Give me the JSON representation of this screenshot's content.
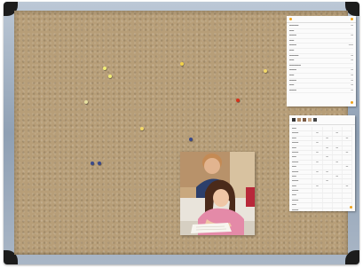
{
  "board": {
    "frame_color": "#9fb0c3",
    "cork_color": "#b79e78",
    "corner_color": "#1c1c1c"
  },
  "pins": [
    {
      "color": "#f2ee78"
    },
    {
      "color": "#f2ee78"
    },
    {
      "color": "#e6e0a0"
    },
    {
      "color": "#f2d24a"
    },
    {
      "color": "#d8321c"
    },
    {
      "color": "#f2d86a"
    },
    {
      "color": "#3a4a8a"
    },
    {
      "color": "#3a4a8a"
    },
    {
      "color": "#3a4a8a"
    },
    {
      "color": "#f2d86a"
    }
  ],
  "papers": [
    {
      "name": "settings-sheet",
      "icon": "app-screenshot-icon"
    },
    {
      "name": "schedule-sheet",
      "icon": "app-screenshot-icon"
    }
  ],
  "photo": {
    "subject": "children-studying-photo",
    "icon": "photo-icon"
  }
}
